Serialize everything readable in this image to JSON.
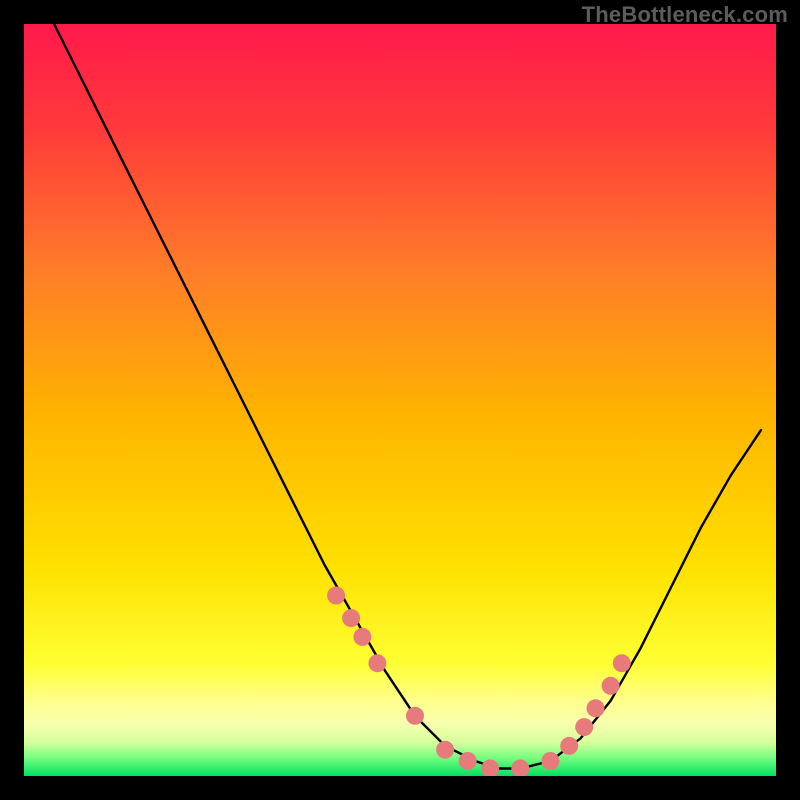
{
  "watermark": "TheBottleneck.com",
  "chart_data": {
    "type": "line",
    "title": "",
    "xlabel": "",
    "ylabel": "",
    "xlim": [
      0,
      100
    ],
    "ylim": [
      0,
      100
    ],
    "grid": false,
    "legend": false,
    "background_gradient": {
      "top_color": "#ff1a4b",
      "mid_color": "#ffd400",
      "lower_band_color": "#ffff7a",
      "bottom_color": "#00e060"
    },
    "series": [
      {
        "name": "bottleneck-curve",
        "color": "#000000",
        "x": [
          4,
          8,
          12,
          16,
          20,
          24,
          28,
          32,
          36,
          40,
          44,
          48,
          52,
          56,
          60,
          63,
          66,
          70,
          74,
          78,
          82,
          86,
          90,
          94,
          98
        ],
        "y": [
          100,
          92,
          84,
          76,
          68,
          60,
          52,
          44,
          36,
          28,
          21,
          14,
          8,
          4,
          2,
          1,
          1,
          2,
          5,
          10,
          17,
          25,
          33,
          40,
          46
        ]
      }
    ],
    "markers": {
      "name": "highlight-dots",
      "color": "#e77b7b",
      "radius_px": 9,
      "x": [
        41.5,
        43.5,
        45,
        47,
        52,
        56,
        59,
        62,
        66,
        70,
        72.5,
        74.5,
        76,
        78,
        79.5
      ],
      "y": [
        24,
        21,
        18.5,
        15,
        8,
        3.5,
        2,
        1,
        1,
        2,
        4,
        6.5,
        9,
        12,
        15
      ]
    }
  }
}
